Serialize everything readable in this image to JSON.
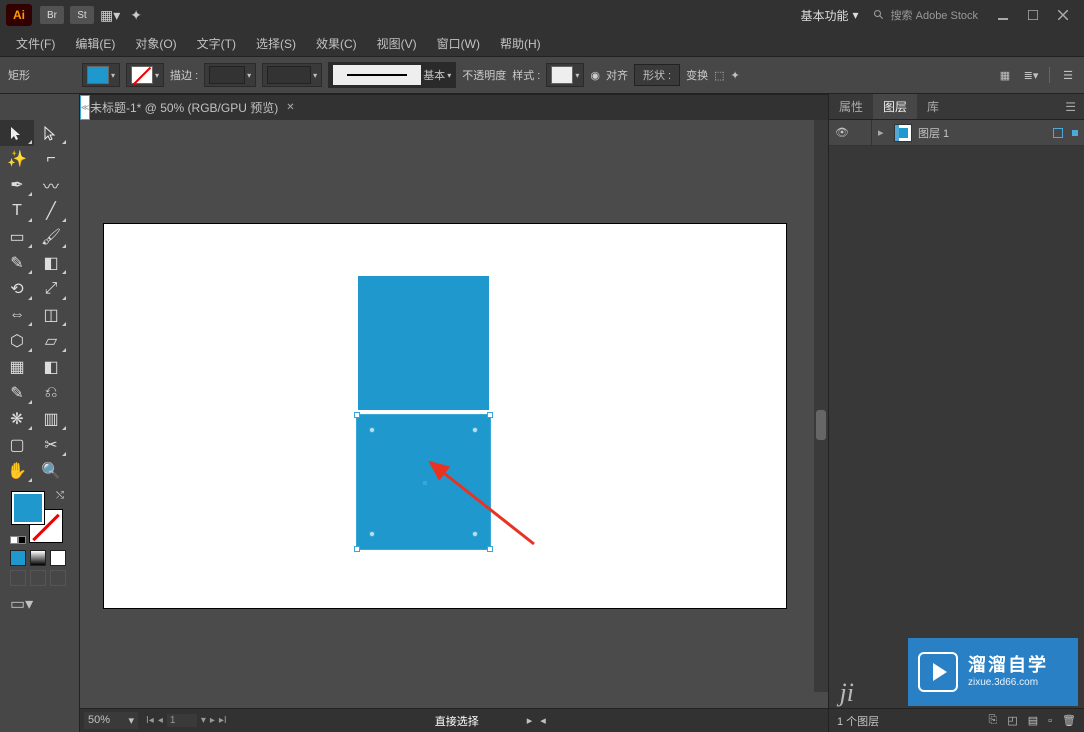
{
  "titlebar": {
    "app_abbrev": "Ai",
    "icon2": "Br",
    "icon3": "St",
    "workspace": "基本功能",
    "search_placeholder": "搜索 Adobe Stock"
  },
  "menu": {
    "file": "文件(F)",
    "edit": "编辑(E)",
    "object": "对象(O)",
    "type": "文字(T)",
    "select": "选择(S)",
    "effect": "效果(C)",
    "view": "视图(V)",
    "window": "窗口(W)",
    "help": "帮助(H)"
  },
  "options": {
    "shape_label": "矩形",
    "fill_color": "#1f98ce",
    "stroke_label": "描边 :",
    "brush_label": "基本",
    "opacity_label": "不透明度",
    "style_label": "样式 :",
    "align_label": "对齐",
    "shape_btn": "形状 :",
    "transform_label": "变换"
  },
  "tab": {
    "title": "未标题-1* @ 50% (RGB/GPU 预览)"
  },
  "panels": {
    "properties": "属性",
    "layers": "图层",
    "libraries": "库",
    "layer_name": "图层 1",
    "footer_count": "1 个图层"
  },
  "status": {
    "zoom": "50%",
    "page": "1",
    "hint": "直接选择"
  },
  "watermark": {
    "brand": "溜溜自学",
    "url": "zixue.3d66.com"
  }
}
